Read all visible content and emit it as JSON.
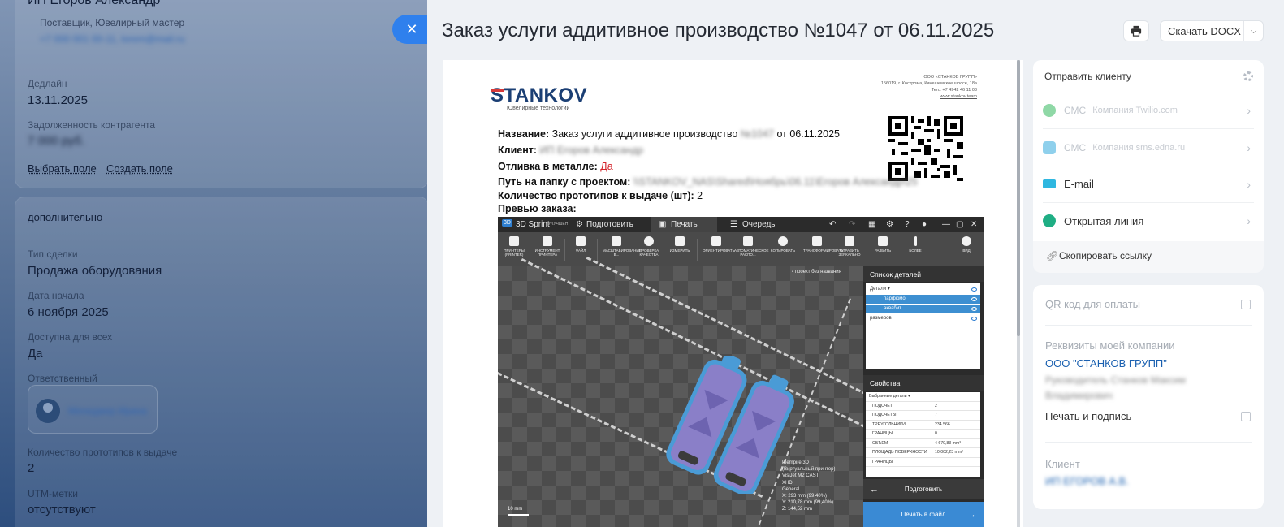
{
  "background": {
    "top_name": "ИП Егоров Александр",
    "top_subtitle": "Поставщик, Ювелирный мастер",
    "top_contacts": "+7 000 001 00-11, lorem@mail.ru",
    "deadline_label": "Дедлайн",
    "deadline_value": "13.11.2025",
    "debt_label": "Задолженность контрагента",
    "debt_value": "7 000 руб.",
    "select_field_link": "Выбрать поле",
    "create_field_link": "Создать поле",
    "section_title": "дополнительно",
    "deal_type_label": "Тип сделки",
    "deal_type_value": "Продажа оборудования",
    "start_date_label": "Дата начала",
    "start_date_value": "6 ноября 2025",
    "available_label": "Доступна для всех",
    "available_value": "Да",
    "responsible_label": "Ответственный",
    "responsible_value": "Менеджер Ирина",
    "prototypes_label": "Количество прототипов к выдаче",
    "prototypes_value": "2",
    "utm_label": "UTM-метки",
    "utm_value": "отсутствуют"
  },
  "slider": {
    "close_icon": "✕",
    "title": "Заказ услуги аддитивное производство №1047 от 06.11.2025",
    "print_icon": "printer-icon",
    "download_label": "Скачать DOCX",
    "download_chevron": "⌵"
  },
  "document": {
    "logo_text": "STANKOV",
    "logo_subtitle": "Ювелирные технологии",
    "company_lines": [
      "ООО «СТАНКОВ ГРУПП»",
      "156019, г. Кострома, Кинешемское шоссе, 18а",
      "Тел.: +7 4942 46 11 03"
    ],
    "company_site": "www.stankov.team",
    "name_label": "Название:",
    "name_value_a": "Заказ услуги аддитивное производство",
    "name_value_hidden": "№1047",
    "name_value_b": "от 06.11.2025",
    "client_label": "Клиент:",
    "client_value": "ИП Егоров Александр",
    "casting_label": "Отливка в металле:",
    "casting_value": "Да",
    "path_label": "Путь на папку с проектом:",
    "path_value": "\\\\STANKOV_NAS\\Shared\\Ноябрь\\06.11\\Егоров Александр\\25",
    "qty_label": "Количество прототипов к выдаче (шт):",
    "qty_value": "2",
    "preview_label": "Превью заказа:"
  },
  "app": {
    "logo_badge": "3D",
    "app_name": "3D Sprint",
    "app_edition": "УЛУЧШЕН",
    "tab_prepare": "Подготовить",
    "tab_print": "Печать",
    "tab_queue": "Очередь",
    "window_controls": [
      "↶",
      "↷",
      "▦",
      "⚙",
      "?",
      "●",
      "—",
      "▢",
      "✕"
    ],
    "tools": [
      "ПРИНТЕРЫ (PRINTER)",
      "ИНСТРУМЕНТ ПРИНТЕРА",
      "ФАЙЛ",
      "МАСШТАБИРОВАНИЕ В...",
      "ПРОВЕРКА КАЧЕСТВА",
      "ИЗМЕРИТЬ",
      "ОРИЕНТИРОВАТЬ",
      "АВТОМАТИЧЕСКОЕ РАСПО...",
      "КОПИРОВАТЬ",
      "ТРАНСФОРМИРОВАТЬ",
      "ОТРАЗИТЬ ЗЕРКАЛЬНО",
      "РАЗБИТЬ",
      "БОЛЕЕ",
      "ВИД"
    ],
    "project_label": "проект без названия",
    "parts_header": "Список деталей",
    "parts_group": "Детали",
    "parts": [
      "парфюмо",
      "аквабит"
    ],
    "parts_extra": "размеров",
    "props_header": "Свойства",
    "props_selected": "Выбранные детали",
    "props": [
      {
        "k": "ПОДСЧЕТ",
        "v": "2"
      },
      {
        "k": "ПОДСЧЕТЫ",
        "v": "7"
      },
      {
        "k": "ТРЕУГОЛЬНИКИ",
        "v": "234 566"
      },
      {
        "k": "ГРАНИЦЫ",
        "v": "0"
      },
      {
        "k": "ОБЪЕМ",
        "v": "4 670,83 mm³"
      },
      {
        "k": "ПЛОЩАДЬ ПОВЕРХНОСТИ",
        "v": "10 002,23 mm²"
      },
      {
        "k": "ГРАНИЦЫ",
        "v": ""
      }
    ],
    "btn_prepare": "Подготовить",
    "btn_print_file": "Печать в файл",
    "printer_lines": [
      "Plempire 3D",
      "(Виртуальный принтер)",
      "VisiJet M2 CAST",
      "XHD",
      "General",
      "X:  293 mm (99,40%)",
      "Y:  210,78 mm (99,40%)",
      "Z:  144,52 mm"
    ],
    "scale_label": "10 mm"
  },
  "right": {
    "send_title": "Отправить клиенту",
    "options": [
      {
        "name": "СМС",
        "sub": "Компания Twilio.com",
        "dim": true,
        "color": "#8fd8a6"
      },
      {
        "name": "СМС",
        "sub": "Компания sms.edna.ru",
        "dim": true,
        "color": "#8fd0ec"
      },
      {
        "name": "E-mail",
        "sub": "",
        "dim": false,
        "color": "#2fb7e0"
      },
      {
        "name": "Открытая линия",
        "sub": "",
        "dim": false,
        "color": "#1fae84"
      }
    ],
    "chev": "›",
    "copy_link": "Скопировать ссылку",
    "qr_label": "QR код для оплаты",
    "requisites_label": "Реквизиты моей компании",
    "company_name": "ООО \"СТАНКОВ ГРУПП\"",
    "director": "Руководитель Станков Максим Владимирович",
    "sign_label": "Печать и подпись",
    "client_label": "Клиент",
    "client_value": "ИП ЕГОРОВ А.В."
  }
}
